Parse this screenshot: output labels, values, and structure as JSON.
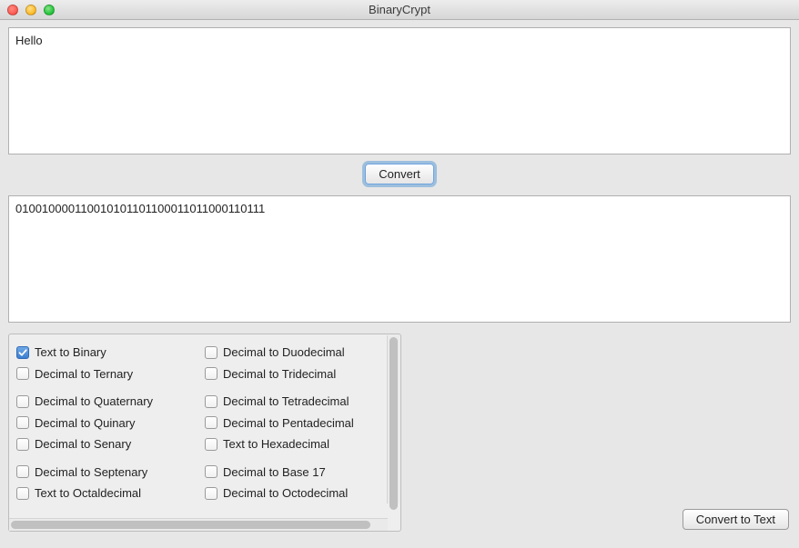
{
  "window": {
    "title": "BinaryCrypt"
  },
  "input": {
    "value": "Hello"
  },
  "output": {
    "value": "010010000110010101101100011011000110111"
  },
  "buttons": {
    "convert": "Convert",
    "convert_to_text": "Convert to Text"
  },
  "options": {
    "col1": [
      {
        "label": "Text to Binary",
        "checked": true,
        "gap": false
      },
      {
        "label": "Decimal to Ternary",
        "checked": false,
        "gap": false
      },
      {
        "label": "Decimal to Quaternary",
        "checked": false,
        "gap": true
      },
      {
        "label": "Decimal to Quinary",
        "checked": false,
        "gap": false
      },
      {
        "label": "Decimal to Senary",
        "checked": false,
        "gap": false
      },
      {
        "label": "Decimal to Septenary",
        "checked": false,
        "gap": true
      },
      {
        "label": "Text to Octaldecimal",
        "checked": false,
        "gap": false
      }
    ],
    "col2": [
      {
        "label": "Decimal to Duodecimal",
        "checked": false,
        "gap": false
      },
      {
        "label": "Decimal to Tridecimal",
        "checked": false,
        "gap": false
      },
      {
        "label": "Decimal to Tetradecimal",
        "checked": false,
        "gap": true
      },
      {
        "label": "Decimal to Pentadecimal",
        "checked": false,
        "gap": false
      },
      {
        "label": "Text to Hexadecimal",
        "checked": false,
        "gap": false
      },
      {
        "label": "Decimal to Base 17",
        "checked": false,
        "gap": true
      },
      {
        "label": "Decimal to Octodecimal",
        "checked": false,
        "gap": false
      }
    ]
  }
}
